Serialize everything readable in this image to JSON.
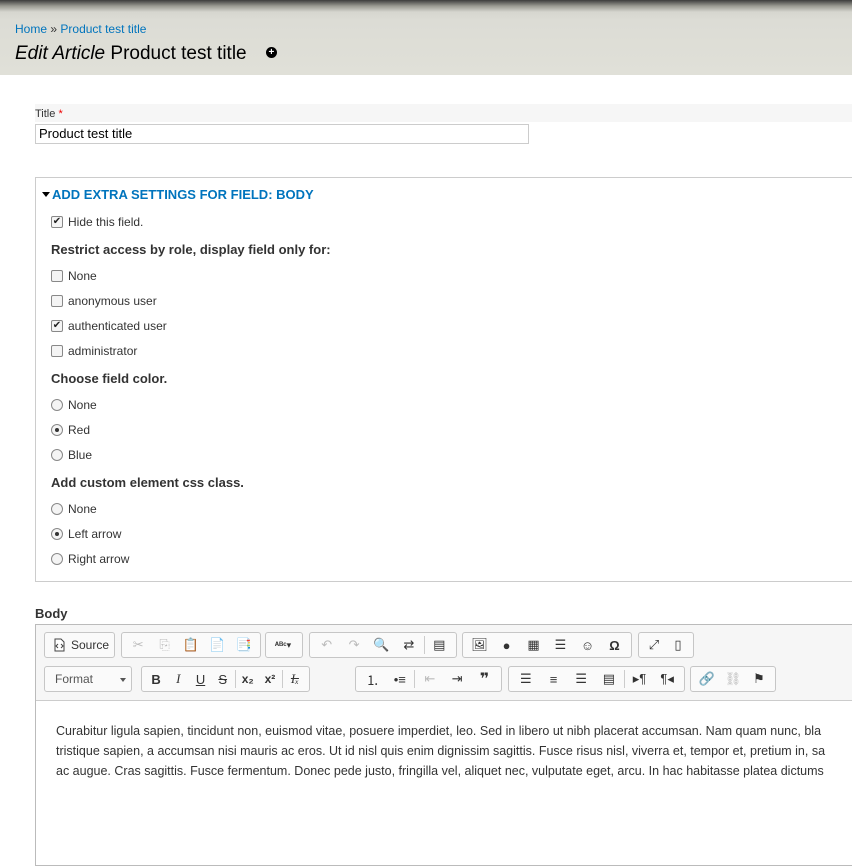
{
  "breadcrumb": {
    "home": "Home",
    "sep": "»",
    "current": "Product test title"
  },
  "page": {
    "title_prefix": "Edit Article",
    "title_name": "Product test title",
    "shortcut_icon": "+"
  },
  "title_field": {
    "label": "Title",
    "required": "*",
    "value": "Product test title"
  },
  "fieldset": {
    "legend": "Add extra settings for field: Body",
    "hide_field": {
      "label": "Hide this field.",
      "checked": true
    },
    "roles": {
      "title": "Restrict access by role, display field only for:",
      "items": [
        {
          "label": "None",
          "checked": false
        },
        {
          "label": "anonymous user",
          "checked": false
        },
        {
          "label": "authenticated user",
          "checked": true
        },
        {
          "label": "administrator",
          "checked": false
        }
      ]
    },
    "color": {
      "title": "Choose field color.",
      "items": [
        {
          "label": "None",
          "selected": false
        },
        {
          "label": "Red",
          "selected": true
        },
        {
          "label": "Blue",
          "selected": false
        }
      ]
    },
    "css_class": {
      "title": "Add custom element css class.",
      "items": [
        {
          "label": "None",
          "selected": false
        },
        {
          "label": "Left arrow",
          "selected": true
        },
        {
          "label": "Right arrow",
          "selected": false
        }
      ]
    }
  },
  "body": {
    "label": "Body",
    "toolbar": {
      "source_label": "Source",
      "format_label": "Format"
    },
    "content_lines": [
      "Curabitur ligula sapien, tincidunt non, euismod vitae, posuere imperdiet, leo. Sed in libero ut nibh placerat accumsan. Nam quam nunc, bla",
      "tristique sapien, a accumsan nisi mauris ac eros. Ut id nisl quis enim dignissim sagittis. Fusce risus nisl, viverra et, tempor et, pretium in, sa",
      "ac augue. Cras sagittis. Fusce fermentum. Donec pede justo, fringilla vel, aliquet nec, vulputate eget, arcu. In hac habitasse platea dictums"
    ]
  }
}
